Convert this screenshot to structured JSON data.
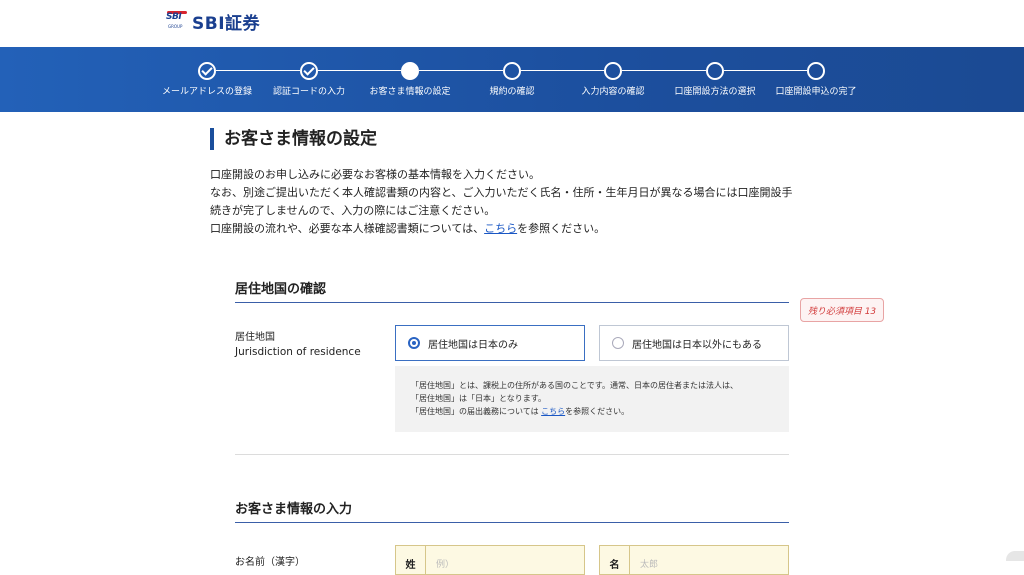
{
  "brand": {
    "mark": "SBI",
    "mark_sub": "GROUP",
    "name": "SBI証券"
  },
  "progress": {
    "steps": [
      {
        "label": "メールアドレスの登録",
        "state": "done"
      },
      {
        "label": "認証コードの入力",
        "state": "done"
      },
      {
        "label": "お客さま情報の設定",
        "state": "current"
      },
      {
        "label": "規約の確認",
        "state": "todo"
      },
      {
        "label": "入力内容の確認",
        "state": "todo"
      },
      {
        "label": "口座開設方法の選択",
        "state": "todo"
      },
      {
        "label": "口座開設申込の完了",
        "state": "todo"
      }
    ]
  },
  "page": {
    "title": "お客さま情報の設定",
    "intro_line1": "口座開設のお申し込みに必要なお客様の基本情報を入力ください。",
    "intro_line2": "なお、別途ご提出いただく本人確認書類の内容と、ご入力いただく氏名・住所・生年月日が異なる場合には口座開設手",
    "intro_line3": "続きが完了しませんので、入力の際にはご注意ください。",
    "intro_line4_pre": "口座開設の流れや、必要な本人様確認書類については、",
    "intro_link": "こちら",
    "intro_line4_post": "を参照ください。"
  },
  "residence": {
    "section_title": "居住地国の確認",
    "badge": "残り必須項目 13",
    "label_ja": "居住地国",
    "label_en": "Jurisdiction of residence",
    "option_japan": "居住地国は日本のみ",
    "option_other": "居住地国は日本以外にもある",
    "selected": "option_japan",
    "note_line1": "「居住地国」とは、課税上の住所がある国のことです。通常、日本の居住者または法人は、",
    "note_line2": "「居住地国」は「日本」となります。",
    "note_line3_pre": "「居住地国」の届出義務については",
    "note_link": "こちら",
    "note_line3_post": "を参照ください。"
  },
  "customer": {
    "section_title": "お客さま情報の入力",
    "name_label": "お名前（漢字）",
    "sei_prefix": "姓",
    "sei_placeholder": "例）",
    "mei_prefix": "名",
    "mei_placeholder": "太郎"
  },
  "colors": {
    "accent": "#1a4e9c",
    "band": "#2361b8",
    "badge": "#d23c3c"
  }
}
